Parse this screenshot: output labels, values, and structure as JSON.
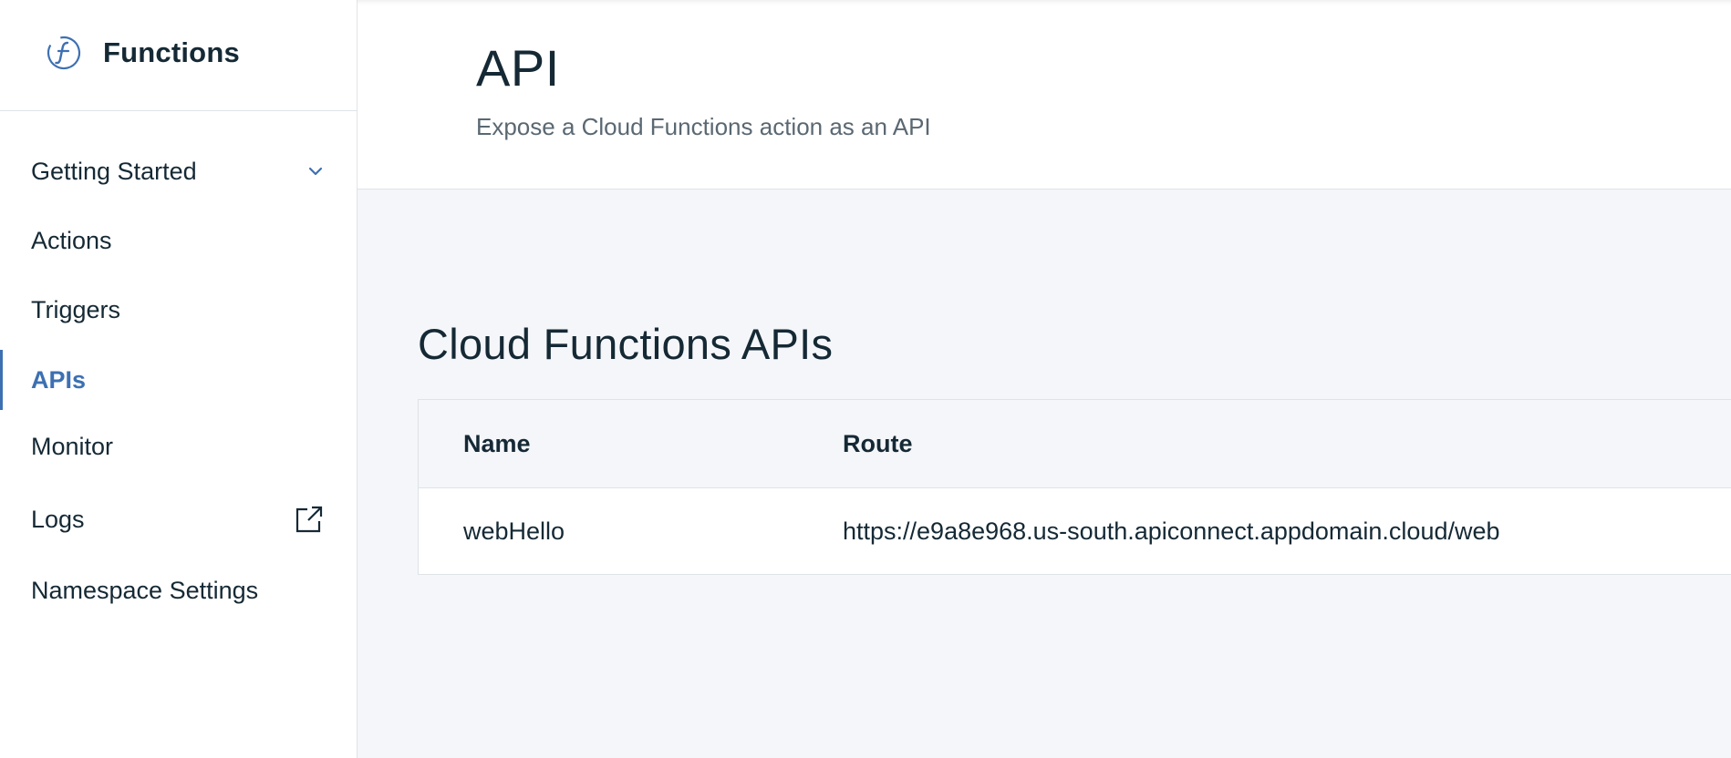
{
  "sidebar": {
    "title": "Functions",
    "items": [
      {
        "label": "Getting Started",
        "trailing_icon": "chevron-down-icon"
      },
      {
        "label": "Actions"
      },
      {
        "label": "Triggers"
      },
      {
        "label": "APIs",
        "active": true
      },
      {
        "label": "Monitor"
      },
      {
        "label": "Logs",
        "trailing_icon": "external-link-icon"
      },
      {
        "label": "Namespace Settings"
      }
    ]
  },
  "header": {
    "title": "API",
    "subtitle": "Expose a Cloud Functions action as an API"
  },
  "main": {
    "section_title": "Cloud Functions APIs",
    "table": {
      "columns": [
        "Name",
        "Route"
      ],
      "rows": [
        [
          "webHello",
          "https://e9a8e968.us-south.apiconnect.appdomain.cloud/web"
        ]
      ]
    }
  },
  "colors": {
    "accent": "#3d70b2",
    "text": "#152935",
    "muted": "#5a6872",
    "background": "#f4f6f9",
    "border": "#dfe3e6"
  }
}
